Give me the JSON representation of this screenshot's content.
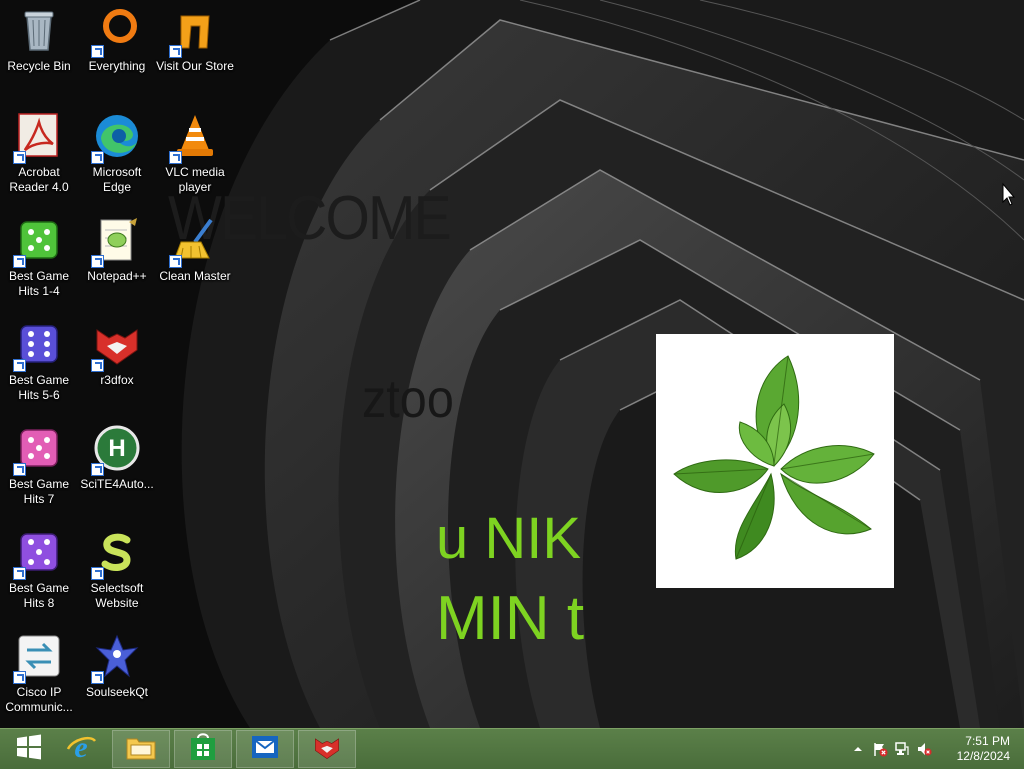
{
  "desktop": {
    "overlay_text": {
      "welcome": "WELCOME",
      "ztoo": "ztoo",
      "unik": "u NIK",
      "mint": "MIN t"
    },
    "icons": [
      {
        "label": "Recycle Bin",
        "icon": "recycle-bin-icon"
      },
      {
        "label": "Everything",
        "icon": "everything-icon"
      },
      {
        "label": "Visit Our Store",
        "icon": "store-icon"
      },
      {
        "label": "Acrobat Reader 4.0",
        "icon": "acrobat-icon"
      },
      {
        "label": "Microsoft Edge",
        "icon": "edge-icon"
      },
      {
        "label": "VLC media player",
        "icon": "vlc-icon"
      },
      {
        "label": "Best Game Hits 1-4",
        "icon": "dice-icon"
      },
      {
        "label": "Notepad++",
        "icon": "notepad-plus-plus-icon"
      },
      {
        "label": "Clean Master",
        "icon": "broom-icon"
      },
      {
        "label": "Best Game Hits 5-6",
        "icon": "dice-icon"
      },
      {
        "label": "r3dfox",
        "icon": "r3dfox-icon"
      },
      {
        "label": "Best Game Hits 7",
        "icon": "dice-icon"
      },
      {
        "label": "SciTE4Auto...",
        "icon": "scite-icon"
      },
      {
        "label": "Best Game Hits 8",
        "icon": "dice-icon"
      },
      {
        "label": "Selectsoft Website",
        "icon": "selectsoft-icon"
      },
      {
        "label": "Cisco IP Communic...",
        "icon": "cisco-ip-icon"
      },
      {
        "label": "SoulseekQt",
        "icon": "soulseek-icon"
      }
    ]
  },
  "taskbar": {
    "buttons": [
      {
        "name": "start-button",
        "icon": "windows-logo-icon"
      },
      {
        "name": "internet-explorer",
        "icon": "internet-explorer-icon"
      },
      {
        "name": "file-explorer",
        "icon": "folder-icon"
      },
      {
        "name": "store",
        "icon": "store-icon"
      },
      {
        "name": "mail",
        "icon": "mail-icon"
      },
      {
        "name": "r3dfox",
        "icon": "r3dfox-icon"
      }
    ],
    "tray": {
      "icons": [
        "chevron-up-icon",
        "action-center-flag-icon",
        "network-icon",
        "volume-muted-icon"
      ],
      "time": "7:51 PM",
      "date": "12/8/2024"
    }
  },
  "colors": {
    "taskbar": "#547a44",
    "accent_text": "#7ed321"
  }
}
